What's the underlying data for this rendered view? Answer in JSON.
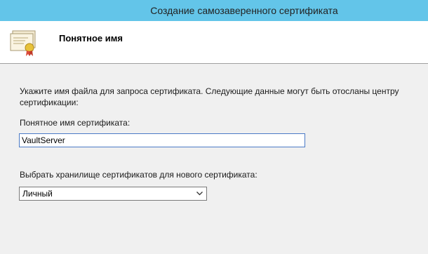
{
  "window": {
    "title": "Создание самозаверенного сертификата"
  },
  "header": {
    "title": "Понятное имя",
    "icon": "certificate-icon"
  },
  "content": {
    "description": "Укажите имя файла для запроса сертификата. Следующие данные могут быть отосланы центру сертификации:",
    "friendly_name_label": "Понятное имя сертификата:",
    "friendly_name_value": "VaultServer",
    "store_label": "Выбрать хранилище сертификатов для нового сертификата:",
    "store_selected": "Личный",
    "store_chevron_icon": "chevron-down-icon"
  },
  "colors": {
    "titlebar": "#63c5e9",
    "input_border_focus": "#4b7ac6"
  }
}
